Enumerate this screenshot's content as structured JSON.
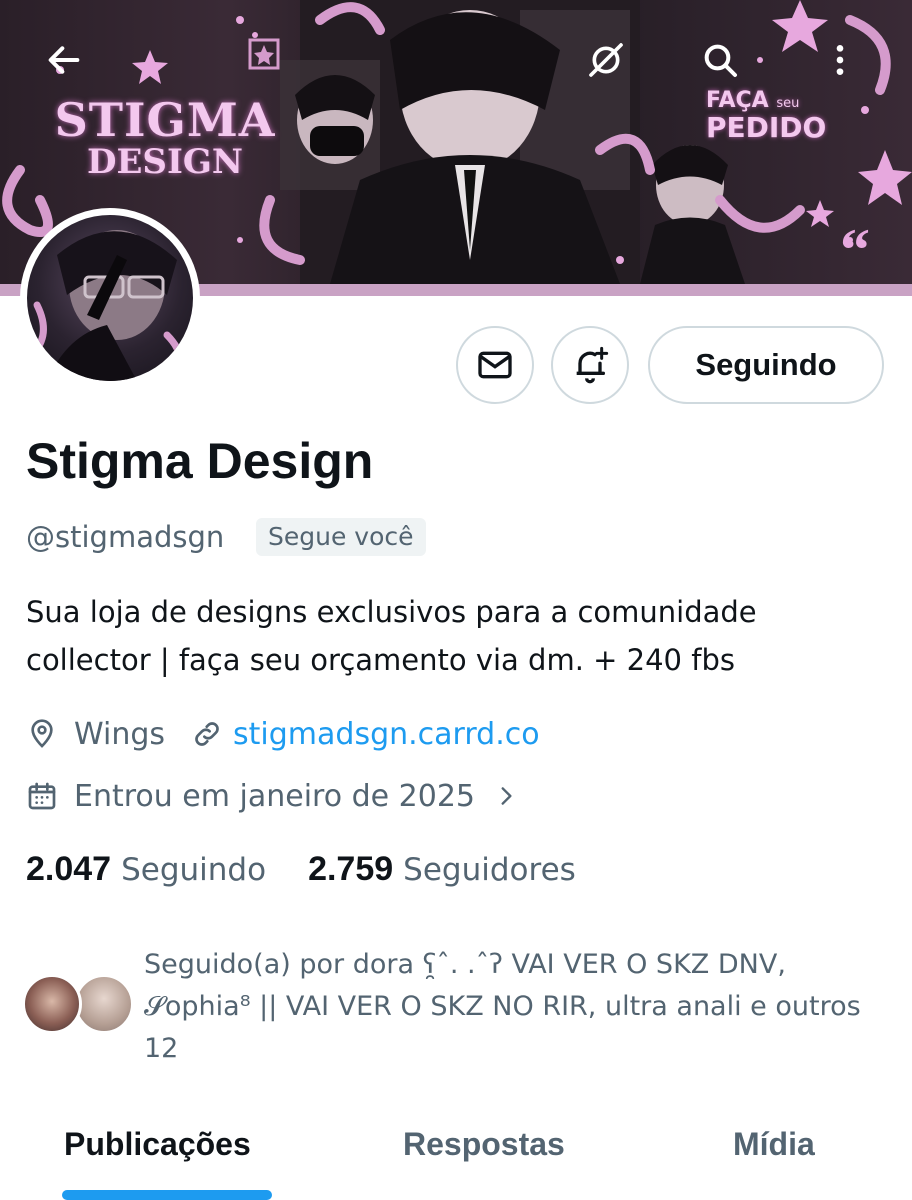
{
  "header": {
    "back_icon": "arrow-left-icon",
    "grok_icon": "grok-icon",
    "search_icon": "search-icon",
    "more_icon": "more-vertical-icon"
  },
  "banner": {
    "logo_line1": "STIGMA",
    "logo_line2": "DESIGN",
    "promo_small1": "FAÇA",
    "promo_small2": "seu",
    "promo_big": "PEDIDO",
    "accent_color": "#c9a2c4"
  },
  "actions": {
    "message_icon": "mail-icon",
    "notify_icon": "bell-plus-icon",
    "follow_label": "Seguindo"
  },
  "profile": {
    "display_name": "Stigma Design",
    "handle": "@stigmadsgn",
    "follows_you": "Segue você",
    "bio": "Sua loja de designs exclusivos para a comunidade collector | faça seu orçamento via dm. + 240 fbs",
    "location": "Wings",
    "website": "stigmadsgn.carrd.co",
    "joined": "Entrou em janeiro de 2025"
  },
  "stats": {
    "following_count": "2.047",
    "following_label": "Seguindo",
    "followers_count": "2.759",
    "followers_label": "Seguidores"
  },
  "followed_by": {
    "text": "Seguido(a) por dora ʕ̯ˆ. .ˆʔ VAI VER O SKZ DNV, 𝓢ophia⁸ || VAI VER O SKZ NO RIR, ultra anali e outros 12"
  },
  "tabs": [
    {
      "label": "Publicações",
      "active": true
    },
    {
      "label": "Respostas",
      "active": false
    },
    {
      "label": "Mídia",
      "active": false
    }
  ],
  "colors": {
    "link": "#1d9bf0",
    "secondary_text": "#536471",
    "primary_text": "#0f1419"
  }
}
